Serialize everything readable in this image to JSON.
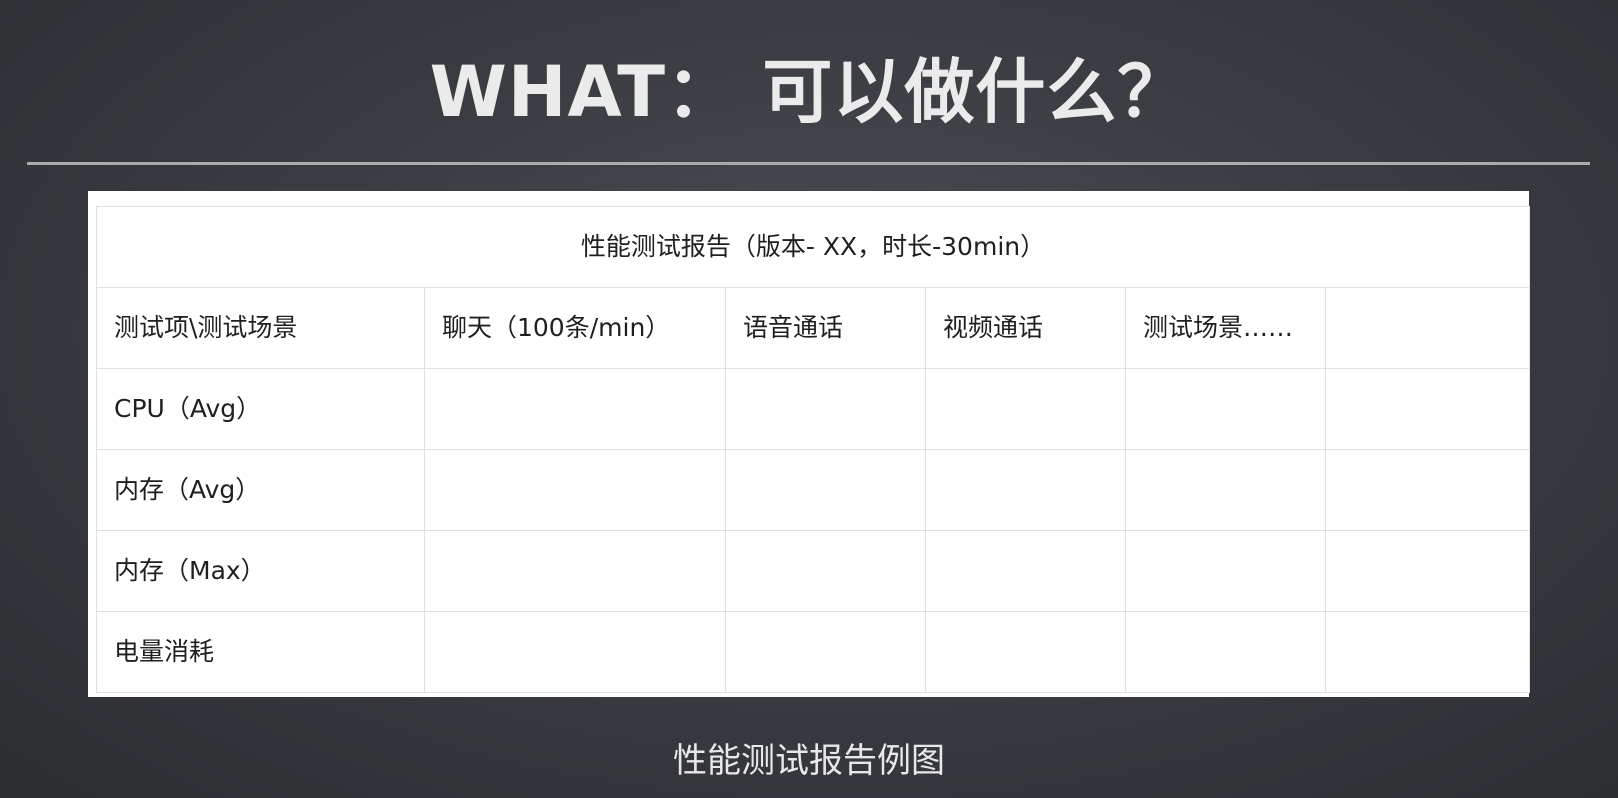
{
  "slide": {
    "title": "WHAT： 可以做什么？",
    "caption": "性能测试报告例图"
  },
  "table": {
    "title": "性能测试报告（版本- XX，时长-30min）",
    "headers": [
      "测试项\\测试场景",
      "聊天（100条/min）",
      "语音通话",
      "视频通话",
      "测试场景……",
      ""
    ],
    "rows": [
      [
        "CPU（Avg）",
        "",
        "",
        "",
        "",
        ""
      ],
      [
        "内存（Avg）",
        "",
        "",
        "",
        "",
        ""
      ],
      [
        "内存（Max）",
        "",
        "",
        "",
        "",
        ""
      ],
      [
        "电量消耗",
        "",
        "",
        "",
        "",
        ""
      ]
    ]
  },
  "colors": {
    "background": "#3a3d42",
    "title_text": "#ebebeb",
    "rule": "#a9abad",
    "table_bg": "#ffffff",
    "table_border": "#e0e0e0"
  }
}
